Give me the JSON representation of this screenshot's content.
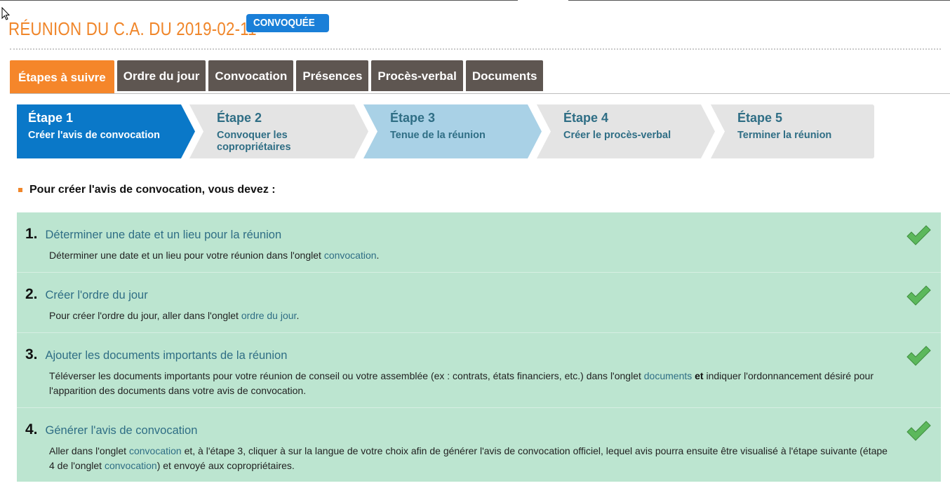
{
  "header": {
    "title": "RÉUNION DU C.A. DU 2019-02-11",
    "status": "CONVOQUÉE"
  },
  "tabs": [
    {
      "label": "Étapes à suivre",
      "active": true
    },
    {
      "label": "Ordre du jour"
    },
    {
      "label": "Convocation"
    },
    {
      "label": "Présences"
    },
    {
      "label": "Procès-verbal"
    },
    {
      "label": "Documents"
    }
  ],
  "steps": [
    {
      "number": "Étape 1",
      "label": "Créer l'avis de convocation",
      "state": "current"
    },
    {
      "number": "Étape 2",
      "label": "Convoquer les copropriétaires",
      "state": "inactive"
    },
    {
      "number": "Étape 3",
      "label": "Tenue de la réunion",
      "state": "next"
    },
    {
      "number": "Étape 4",
      "label": "Créer le procès-verbal",
      "state": "inactive"
    },
    {
      "number": "Étape 5",
      "label": "Terminer la réunion",
      "state": "inactive"
    }
  ],
  "intro": "Pour créer l'avis de convocation, vous devez :",
  "tasks": [
    {
      "number": "1.",
      "title": "Déterminer une date et un lieu pour la réunion",
      "desc_before": "Déterminer une date et un lieu pour votre réunion dans l'onglet ",
      "desc_link": "convocation",
      "desc_after": ".",
      "done": true
    },
    {
      "number": "2.",
      "title": "Créer l'ordre du jour",
      "desc_before": "Pour créer l'ordre du jour, aller dans l'onglet ",
      "desc_link": "ordre du jour",
      "desc_after": ".",
      "done": true
    },
    {
      "number": "3.",
      "title": "Ajouter les documents importants de la réunion",
      "desc_before": "Téléverser les documents importants pour votre réunion de conseil ou votre assemblée (ex : contrats, états financiers, etc.) dans l'onglet ",
      "desc_link": "documents",
      "desc_bold": "et",
      "desc_after": " indiquer l'ordonnancement désiré pour l'apparition des documents dans votre avis de convocation.",
      "done": true
    },
    {
      "number": "4.",
      "title": "Générer l'avis de convocation",
      "desc_before": "Aller dans l'onglet ",
      "desc_link": "convocation",
      "desc_mid": " et, à l'étape 3, cliquer à sur la langue de votre choix afin de générer l'avis de convocation officiel, lequel avis pourra ensuite être visualisé à l'étape suivante (étape 4 de l'onglet ",
      "desc_link2": "convocation",
      "desc_after": ") et envoyé aux copropriétaires.",
      "done": true
    }
  ],
  "colors": {
    "accent": "#f0862a",
    "badge": "#1a7fd8",
    "step_current": "#0a78c8",
    "step_next": "#a9d1e6",
    "step_inactive": "#e4e4e4",
    "task_bg": "#bce5d0",
    "link": "#2f6e85",
    "check": "#5cb85c"
  }
}
